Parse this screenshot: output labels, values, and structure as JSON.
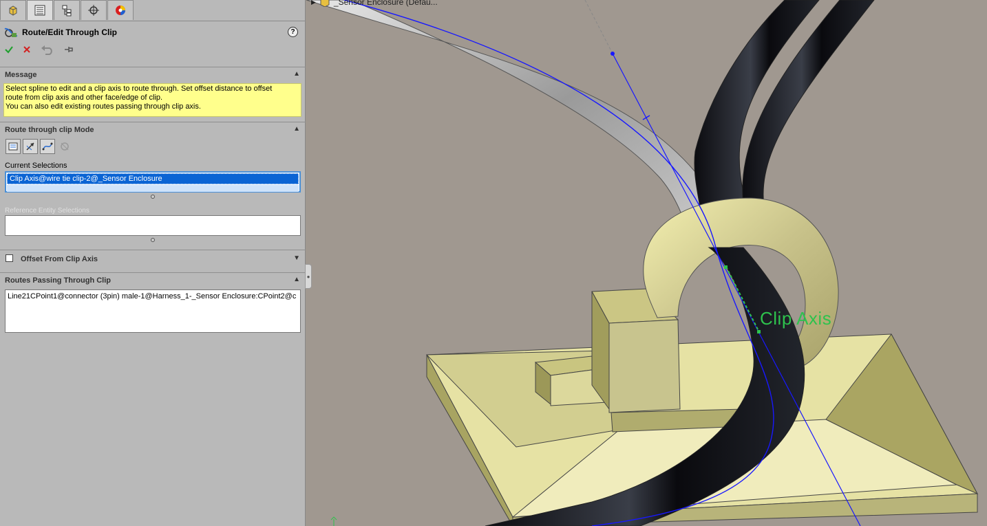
{
  "title": "Route/Edit Through Clip",
  "help": "?",
  "tabs": [
    "feature-manager",
    "property-manager",
    "configuration-manager",
    "dimxpert-manager",
    "display-manager"
  ],
  "message": {
    "header": "Message",
    "text_line1": "Select spline to edit and a clip axis to route through. Set offset distance to offset",
    "text_line2": "route from clip axis and other face/edge of clip.",
    "text_line3": "You can also edit existing routes passing through clip axis."
  },
  "mode": {
    "header": "Route through clip Mode",
    "current_selections_label": "Current Selections",
    "selection_value": "Clip Axis@wire tie clip-2@_Sensor Enclosure",
    "reference_label": "Reference Entity Selections"
  },
  "offset": {
    "label": "Offset From Clip Axis",
    "checked": false
  },
  "routes": {
    "header": "Routes Passing Through Clip",
    "value": "Line21CPoint1@connector (3pin) male-1@Harness_1-_Sensor Enclosure:CPoint2@c"
  },
  "viewport": {
    "tree_label": "_Sensor Enclosure  (Defau...",
    "clip_axis_label": "Clip Axis"
  },
  "colors": {
    "message_bg": "#ffff8c",
    "selection_bg": "#0a64d4",
    "clip_axis": "#2ec24d",
    "spline": "#0000ff"
  }
}
